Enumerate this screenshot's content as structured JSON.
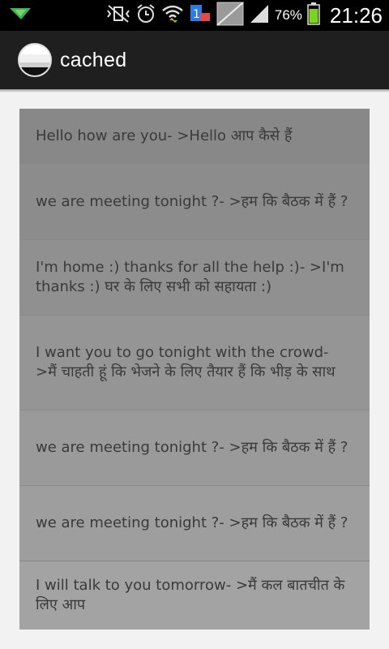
{
  "status_bar": {
    "battery_percent": "76%",
    "time": "21:26",
    "colors": {
      "battery": "#7ed321",
      "background": "#000000"
    }
  },
  "action_bar": {
    "title": "cached",
    "icon": "app-logo-icon"
  },
  "list": {
    "items": [
      {
        "text": "Hello how are you- >Hello  आप कैसे हैं",
        "bg": "#888888"
      },
      {
        "text": "we are meeting tonight ?- >हम  कि  बैठक में  हैं  ?",
        "bg": "#8c8c8c"
      },
      {
        "text": "I'm home :) thanks for all the help :)- >I'm  thanks  :)  घर  के लिए  सभी  को सहायता  :)",
        "bg": "#909090"
      },
      {
        "text": "I want you to go tonight with the crowd- >मैं चाहती हूं कि  भेजने के लिए तैयार हैं  कि  भीड़  के  साथ",
        "bg": "#959595"
      },
      {
        "text": "we are meeting tonight ?- >हम  कि  बैठक में  हैं  ?",
        "bg": "#9a9a9a"
      },
      {
        "text": "we are meeting tonight ?- >हम  कि  बैठक में  हैं  ?",
        "bg": "#9e9e9e"
      },
      {
        "text": "I will talk to you tomorrow- >मैं  कल  बातचीत  के लिए  आप",
        "bg": "#a3a3a3"
      }
    ]
  }
}
